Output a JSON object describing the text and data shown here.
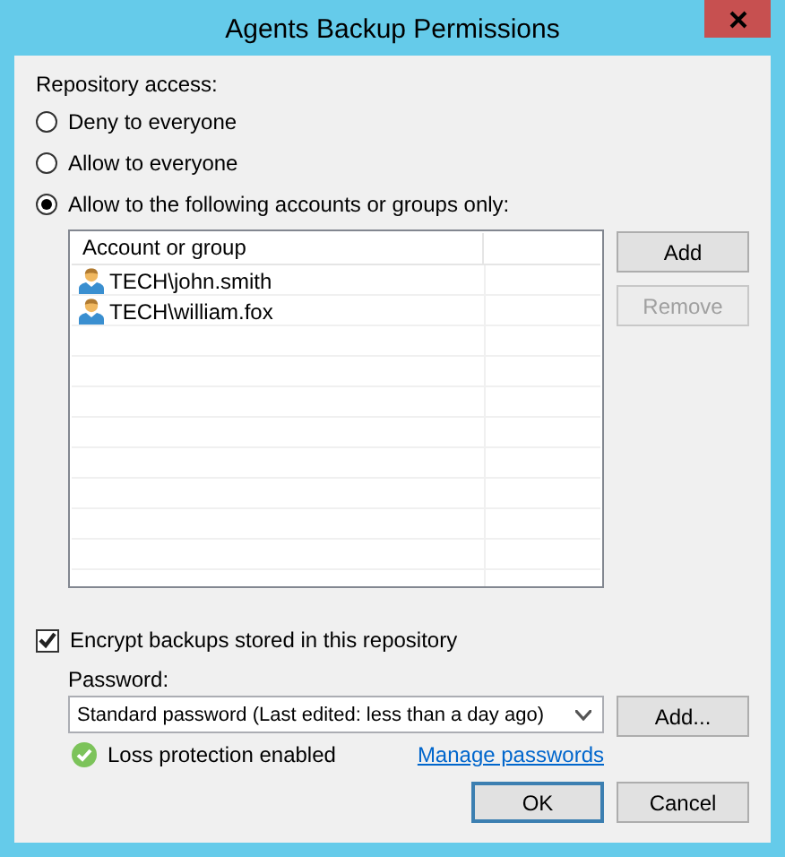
{
  "window": {
    "title": "Agents Backup Permissions"
  },
  "repository_access": {
    "label": "Repository access:",
    "options": [
      {
        "label": "Deny to everyone",
        "selected": false
      },
      {
        "label": "Allow to everyone",
        "selected": false
      },
      {
        "label": "Allow to the following accounts or groups only:",
        "selected": true
      }
    ]
  },
  "accounts": {
    "columns": [
      "Account or group"
    ],
    "rows": [
      {
        "name": "TECH\\john.smith"
      },
      {
        "name": "TECH\\william.fox"
      }
    ],
    "buttons": [
      {
        "label": "Add",
        "disabled": false
      },
      {
        "label": "Remove",
        "disabled": true
      }
    ]
  },
  "encrypt": {
    "label": "Encrypt backups stored in this repository",
    "checked": true
  },
  "password": {
    "label": "Password:",
    "value": "Standard password (Last edited: less than a day ago)",
    "button": "Add...",
    "status": "Loss protection enabled",
    "link": "Manage passwords"
  },
  "buttons": [
    {
      "label": "OK",
      "default": true
    },
    {
      "label": "Cancel",
      "default": false
    }
  ]
}
